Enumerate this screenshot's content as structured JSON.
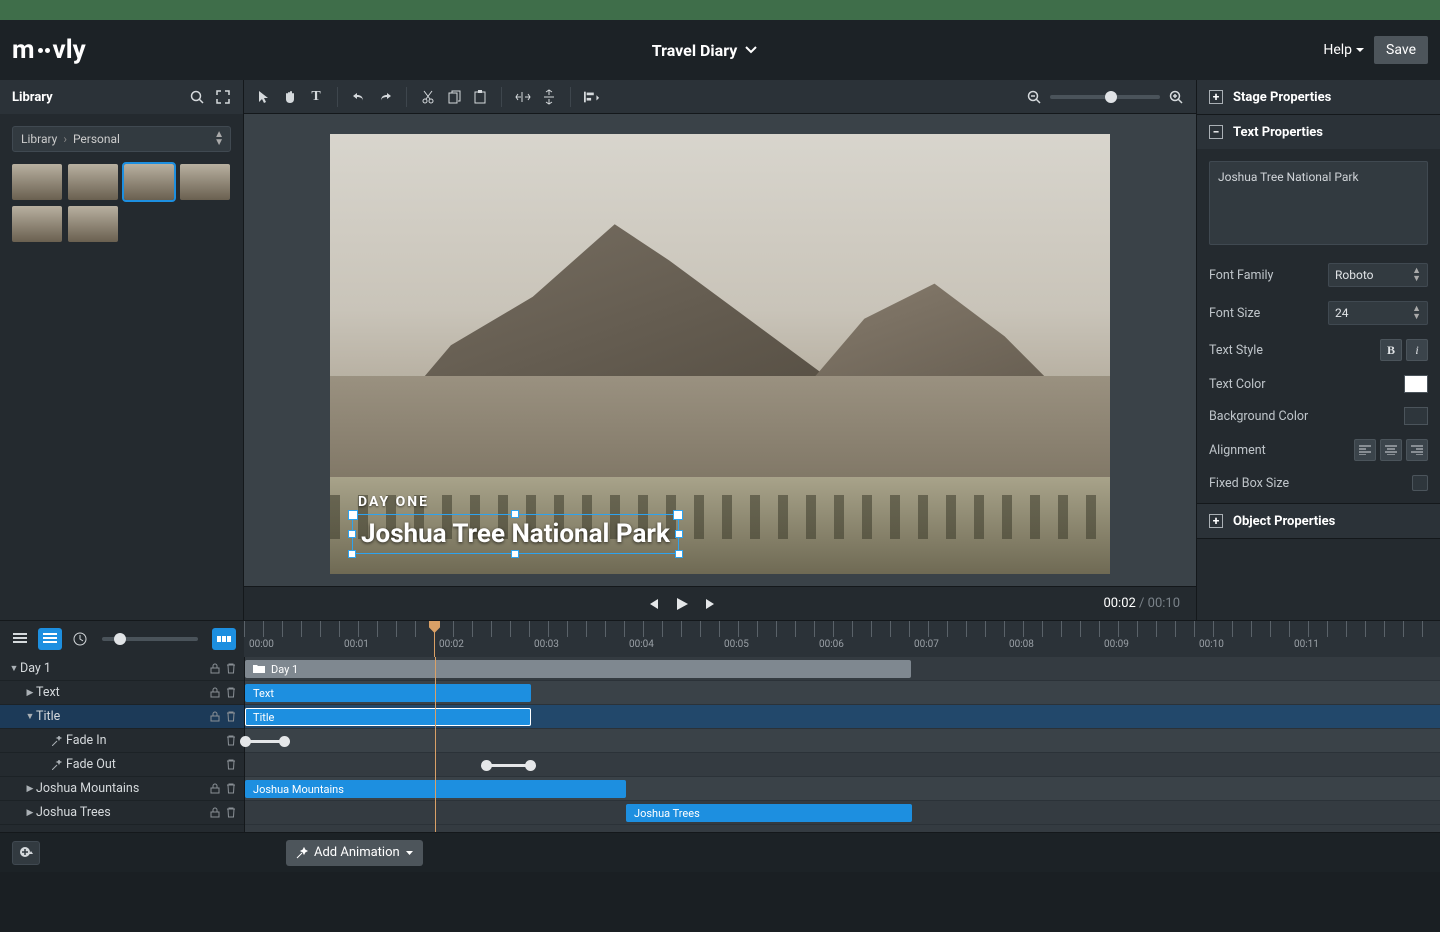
{
  "project": {
    "title": "Travel Diary"
  },
  "header": {
    "help": "Help",
    "save": "Save",
    "logo": "moovly"
  },
  "library": {
    "title": "Library",
    "breadcrumb": {
      "root": "Library",
      "current": "Personal"
    }
  },
  "stage": {
    "overline": "DAY ONE",
    "title": "Joshua Tree National Park"
  },
  "playback": {
    "current": "00:02",
    "total": "00:10"
  },
  "inspector": {
    "stage_props": "Stage Properties",
    "text_props": "Text Properties",
    "object_props": "Object Properties",
    "text_value": "Joshua Tree National Park",
    "labels": {
      "font_family": "Font Family",
      "font_size": "Font Size",
      "text_style": "Text Style",
      "text_color": "Text Color",
      "bg_color": "Background Color",
      "alignment": "Alignment",
      "fixed_box": "Fixed Box Size"
    },
    "font_family": "Roboto",
    "font_size": "24"
  },
  "timeline": {
    "ruler": [
      "00:00",
      "00:01",
      "00:02",
      "00:03",
      "00:04",
      "00:05",
      "00:06",
      "00:07",
      "00:08",
      "00:09",
      "00:10",
      "00:11"
    ],
    "playhead_pos": "00:02",
    "tracks": [
      {
        "label": "Day 1",
        "type": "folder"
      },
      {
        "label": "Text",
        "type": "clip"
      },
      {
        "label": "Title",
        "type": "clip",
        "selected": true
      },
      {
        "label": "Fade In",
        "type": "anim"
      },
      {
        "label": "Fade Out",
        "type": "anim"
      },
      {
        "label": "Joshua Mountains",
        "type": "clip"
      },
      {
        "label": "Joshua Trees",
        "type": "clip"
      }
    ],
    "clips": {
      "day1": "Day 1",
      "text": "Text",
      "title": "Title",
      "jm": "Joshua Mountains",
      "jt": "Joshua Trees"
    },
    "add_animation": "Add Animation"
  }
}
